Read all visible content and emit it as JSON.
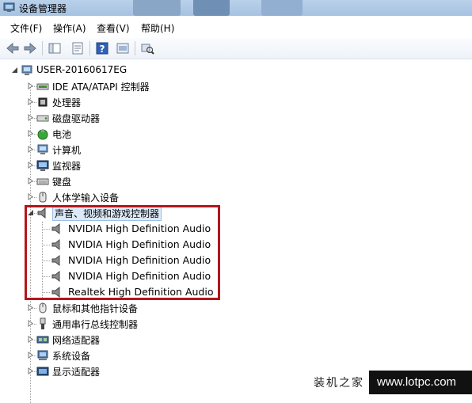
{
  "window": {
    "title": "设备管理器"
  },
  "menu": [
    "文件(F)",
    "操作(A)",
    "查看(V)",
    "帮助(H)"
  ],
  "toolbar": [
    {
      "name": "back-icon"
    },
    {
      "name": "forward-icon"
    },
    {
      "name": "show-hide-tree-icon"
    },
    {
      "name": "properties-icon"
    },
    {
      "name": "help-icon"
    },
    {
      "name": "update-driver-icon"
    },
    {
      "name": "scan-hardware-icon"
    }
  ],
  "tree": {
    "root": "USER-20160617EG",
    "categories": [
      {
        "label": "IDE ATA/ATAPI 控制器",
        "icon": "ide-controller-icon"
      },
      {
        "label": "处理器",
        "icon": "processor-icon"
      },
      {
        "label": "磁盘驱动器",
        "icon": "disk-drive-icon"
      },
      {
        "label": "电池",
        "icon": "battery-icon"
      },
      {
        "label": "计算机",
        "icon": "computer-icon"
      },
      {
        "label": "监视器",
        "icon": "monitor-icon"
      },
      {
        "label": "键盘",
        "icon": "keyboard-icon"
      },
      {
        "label": "人体学输入设备",
        "icon": "hid-icon"
      },
      {
        "label": "声音、视频和游戏控制器",
        "icon": "speaker-icon",
        "expanded": true,
        "children": [
          "NVIDIA High Definition Audio",
          "NVIDIA High Definition Audio",
          "NVIDIA High Definition Audio",
          "NVIDIA High Definition Audio",
          "Realtek High Definition Audio"
        ]
      },
      {
        "label": "鼠标和其他指针设备",
        "icon": "mouse-icon"
      },
      {
        "label": "通用串行总线控制器",
        "icon": "usb-icon"
      },
      {
        "label": "网络适配器",
        "icon": "network-adapter-icon"
      },
      {
        "label": "系统设备",
        "icon": "system-device-icon"
      },
      {
        "label": "显示适配器",
        "icon": "display-adapter-icon"
      }
    ]
  },
  "watermark": {
    "left": "装机之家",
    "right": "www.lotpc.com"
  },
  "colors": {
    "highlight": "#b3161c",
    "titlebar": "#b9d1ea"
  }
}
